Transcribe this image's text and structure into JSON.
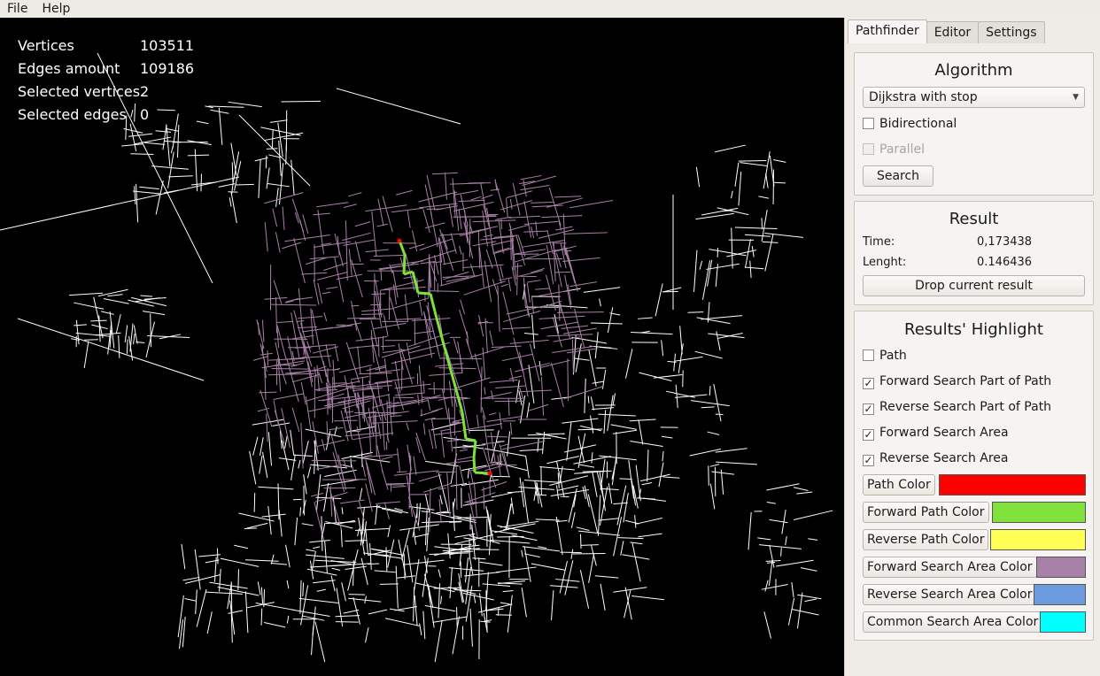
{
  "menu": {
    "file": "File",
    "help": "Help"
  },
  "stats": [
    {
      "label": "Vertices",
      "value": "103511"
    },
    {
      "label": "Edges amount",
      "value": "109186"
    },
    {
      "label": "Selected vertices",
      "value": "2"
    },
    {
      "label": "Selected edges",
      "value": "0"
    }
  ],
  "tabs": {
    "pathfinder": "Pathfinder",
    "editor": "Editor",
    "settings": "Settings"
  },
  "algorithm": {
    "title": "Algorithm",
    "selected": "Dijkstra with stop",
    "bidirectional": "Bidirectional",
    "parallel": "Parallel",
    "search_button": "Search"
  },
  "result": {
    "title": "Result",
    "time_label": "Time:",
    "time_value": "0,173438",
    "length_label": "Lenght:",
    "length_value": "0.146436",
    "drop_button": "Drop current result"
  },
  "highlight": {
    "title": "Results' Highlight",
    "path": "Path",
    "forward_part": "Forward Search Part of Path",
    "reverse_part": "Reverse Search Part of Path",
    "forward_area": "Forward Search Area",
    "reverse_area": "Reverse Search Area",
    "path_color_btn": "Path Color",
    "forward_path_color_btn": "Forward Path Color",
    "reverse_path_color_btn": "Reverse Path Color",
    "forward_area_color_btn": "Forward Search Area Color",
    "reverse_area_color_btn": "Reverse Search Area Color",
    "common_area_color_btn": "Common Search Area Color"
  },
  "colors": {
    "path": "#ff0000",
    "forward_path": "#80e03c",
    "reverse_path": "#ffff55",
    "forward_area": "#a881a8",
    "reverse_area": "#6e9ae0",
    "common_area": "#00ffff",
    "roads": "#ffffff"
  }
}
